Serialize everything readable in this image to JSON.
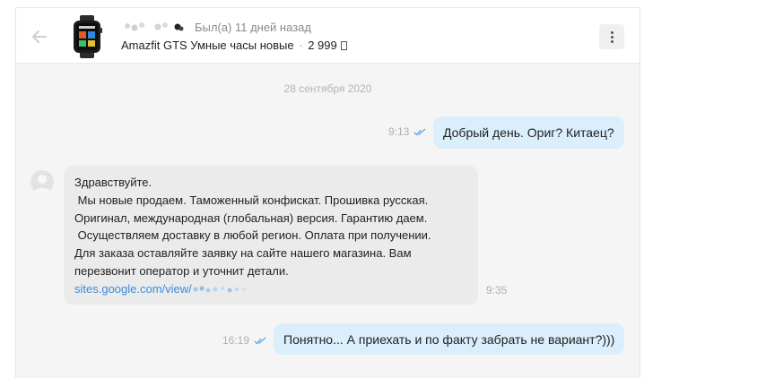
{
  "header": {
    "last_seen": "Был(а) 11 дней назад",
    "listing_title": "Amazfit GTS Умные часы новые",
    "separator": "·",
    "listing_price": "2 999",
    "back_icon": "arrow-left-icon",
    "menu_icon": "more-vertical-icon"
  },
  "date_separator": "28 сентября 2020",
  "messages": [
    {
      "direction": "outgoing",
      "text": "Добрый день. Ориг? Китаец?",
      "time": "9:13",
      "status_icon": "double-check-icon"
    },
    {
      "direction": "incoming",
      "lines": [
        "Здравствуйте.",
        " Мы новые продаем. Таможенный конфискат. Прошивка русская.",
        "Оригинал, международная (глобальная) версия. Гарантию даем.",
        " Осуществляем доставку в любой регион. Оплата при получении.",
        "Для заказа оставляйте заявку на сайте нашего магазина. Вам",
        "перезвонит оператор и уточнит детали."
      ],
      "link_text": "sites.google.com/view/",
      "time": "9:35"
    },
    {
      "direction": "outgoing",
      "text": "Понятно... А приехать и по факту забрать не вариант?)))",
      "time": "16:19",
      "status_icon": "double-check-icon"
    }
  ],
  "colors": {
    "outgoing_bubble": "#dbeefc",
    "incoming_bubble": "#ebebeb",
    "link": "#3f8bd9",
    "read_ticks": "#5aa6e6"
  }
}
